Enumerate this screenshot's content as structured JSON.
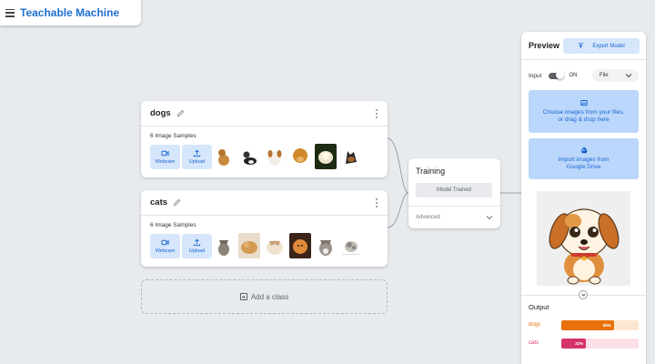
{
  "app": {
    "title": "Teachable Machine"
  },
  "classes": [
    {
      "name": "dogs",
      "samples_label": "6 Image Samples",
      "webcam_label": "Webcam",
      "upload_label": "Upload"
    },
    {
      "name": "cats",
      "samples_label": "6 Image Samples",
      "webcam_label": "Webcam",
      "upload_label": "Upload"
    }
  ],
  "add_class": {
    "label": "Add a class"
  },
  "training": {
    "title": "Training",
    "status_button": "Model Trained",
    "advanced_label": "Advanced"
  },
  "preview": {
    "title": "Preview",
    "export_label": "Export Model",
    "input_label": "Input",
    "toggle_state": "ON",
    "source_select": "File",
    "drop_files_line1": "Choose images from your files,",
    "drop_files_line2": "or drag & drop here",
    "drive_line1": "Import images from",
    "drive_line2": "Google Drive",
    "output_label": "Output",
    "outputs": [
      {
        "label": "dogs",
        "percent": 0.68,
        "display": "68%",
        "color": "#e8710a",
        "track": "#fde7d2"
      },
      {
        "label": "cats",
        "percent": 0.32,
        "display": "32%",
        "color": "#d6336c",
        "track": "#fbe0e6"
      }
    ]
  },
  "colors": {
    "accent": "#1967d2",
    "panel_blue": "#bbd7fb",
    "button_blue": "#d6e6fb"
  }
}
